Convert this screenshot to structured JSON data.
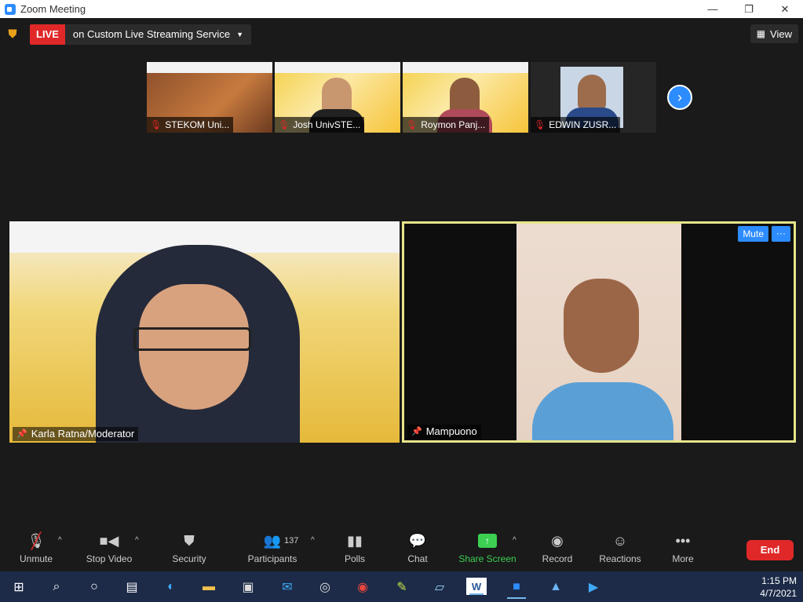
{
  "window": {
    "title": "Zoom Meeting"
  },
  "header": {
    "live_label": "LIVE",
    "live_service": "on Custom Live Streaming Service",
    "view_label": "View"
  },
  "thumbnails": [
    {
      "name": "STEKOM Uni..."
    },
    {
      "name": "Josh UnivSTE..."
    },
    {
      "name": "Roymon Panj..."
    },
    {
      "name": "EDWIN ZUSR..."
    }
  ],
  "tiles": {
    "left": {
      "name": "Karla Ratna/Moderator"
    },
    "right": {
      "name": "Mampuono",
      "mute_label": "Mute",
      "more_label": "···"
    }
  },
  "toolbar": {
    "unmute": "Unmute",
    "stop_video": "Stop Video",
    "security": "Security",
    "participants": "Participants",
    "participant_count": "137",
    "polls": "Polls",
    "chat": "Chat",
    "share_screen": "Share Screen",
    "record": "Record",
    "reactions": "Reactions",
    "more": "More",
    "end": "End"
  },
  "taskbar": {
    "time": "1:15 PM",
    "date": "4/7/2021"
  },
  "colors": {
    "accent": "#2d8cff",
    "live": "#e02828",
    "share": "#3ccf52",
    "active_speaker": "#e6e58a"
  }
}
